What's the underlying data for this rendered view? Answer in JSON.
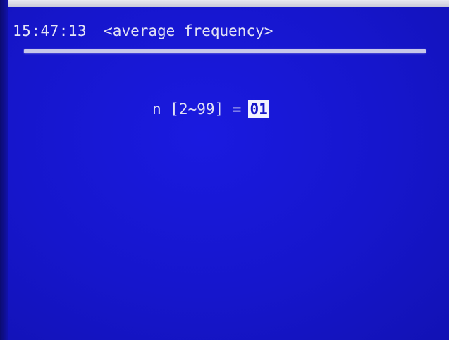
{
  "header": {
    "time": "15:47:13",
    "title": "<average frequency>"
  },
  "parameter": {
    "label": "n [2~99] =",
    "value": "01"
  },
  "colors": {
    "background": "#1616cc",
    "text": "#e0e0f4",
    "highlight_bg": "#f1f1ff",
    "highlight_fg": "#1414c8"
  }
}
